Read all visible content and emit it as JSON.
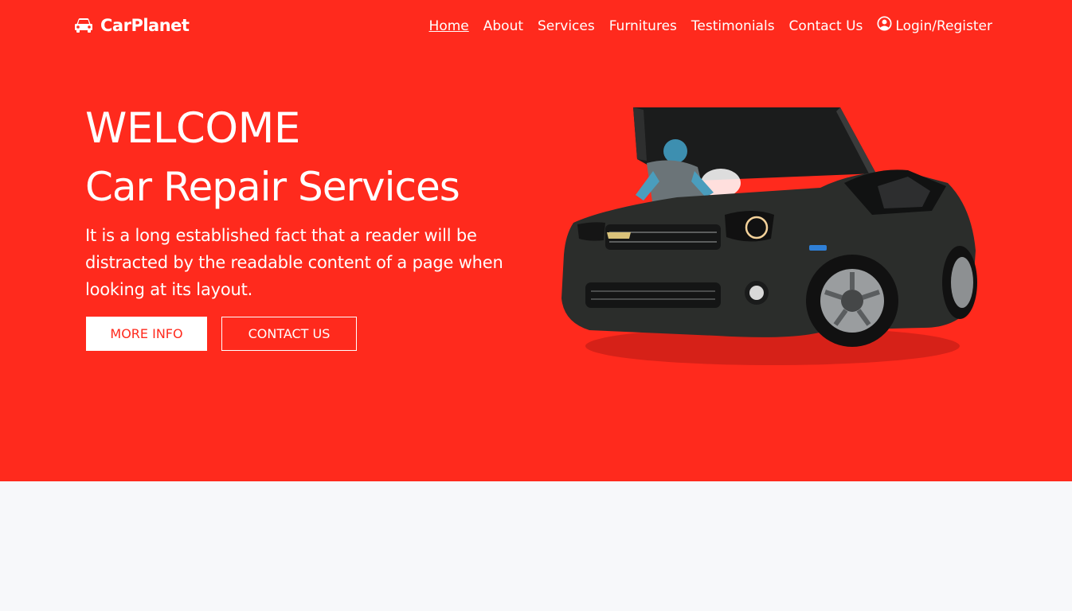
{
  "brand": {
    "name": "CarPlanet",
    "icon": "car-icon"
  },
  "nav": {
    "items": [
      "Home",
      "About",
      "Services",
      "Furnitures",
      "Testimonials",
      "Contact Us"
    ],
    "active": "Home",
    "login_label": "Login/Register",
    "login_icon": "user-circle-icon"
  },
  "hero": {
    "heading": "WELCOME",
    "subheading": "Car Repair Services",
    "description": "It is a long established fact that a reader will be distracted by the readable content of a page when looking at its layout.",
    "more_info_label": "MORE INFO",
    "contact_label": "CONTACT US",
    "image": "mechanic-repairing-car-illustration"
  },
  "colors": {
    "primary": "#ff2a1d",
    "text_on_primary": "#ffffff",
    "page_background": "#f7f8fa",
    "car_body": "#2b2d2b"
  }
}
